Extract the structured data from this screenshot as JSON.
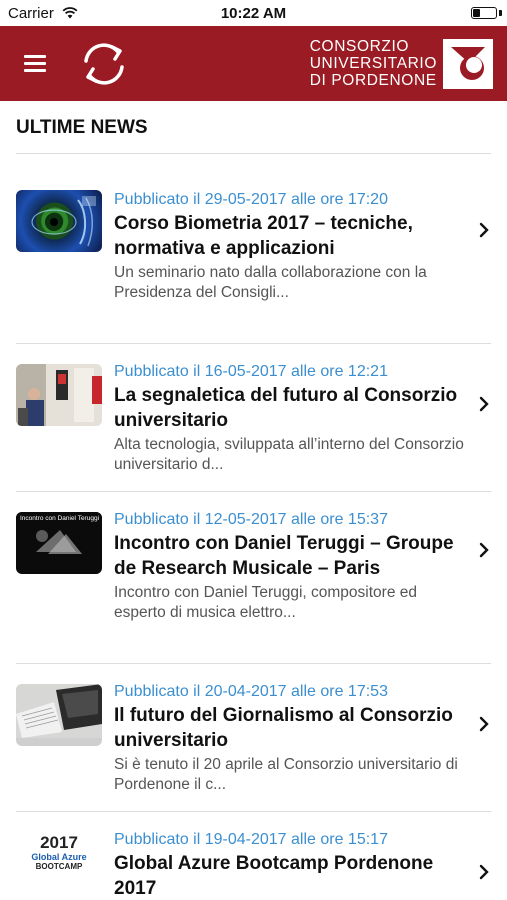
{
  "status_bar": {
    "carrier": "Carrier",
    "time": "10:22 AM",
    "battery_level": 0.3
  },
  "header": {
    "menu_icon": "hamburger-menu-icon",
    "refresh_icon": "refresh-icon",
    "brand_lines": [
      "CONSORZIO",
      "UNIVERSITARIO",
      "DI PORDENONE"
    ],
    "brand_color": "#9b1b24"
  },
  "section_title": "ULTIME NEWS",
  "news": [
    {
      "date": "Pubblicato il 29-05-2017 alle ore 17:20",
      "title": "Corso Biometria 2017 – tecniche, normativa e applicazioni",
      "excerpt": "Un seminario nato dalla collaborazione con la Presidenza del Consigli..."
    },
    {
      "date": "Pubblicato il 16-05-2017 alle ore 12:21",
      "title": "La segnaletica del futuro al Consorzio universitario",
      "excerpt": "Alta tecnologia, sviluppata all’interno del Consorzio universitario d..."
    },
    {
      "date": "Pubblicato il 12-05-2017 alle ore 15:37",
      "title": "Incontro con Daniel Teruggi – Groupe de Research Musicale – Paris",
      "excerpt": "Incontro con Daniel Teruggi, compositore ed esperto di musica elettro...",
      "thumb_caption": "Incontro con Daniel Teruggi"
    },
    {
      "date": "Pubblicato il 20-04-2017 alle ore 17:53",
      "title": "Il futuro del Giornalismo al Consorzio universitario",
      "excerpt": "Si è tenuto il 20 aprile al Consorzio universitario di Pordenone il c..."
    },
    {
      "date": "Pubblicato il 19-04-2017 alle ore 15:17",
      "title": "Global Azure Bootcamp Pordenone 2017",
      "excerpt": "",
      "thumb_caption": [
        "2017",
        "Global Azure",
        "BOOTCAMP"
      ]
    }
  ],
  "colors": {
    "accent": "#9b1b24",
    "date_link": "#3b8fd1",
    "divider": "#dddddd"
  }
}
